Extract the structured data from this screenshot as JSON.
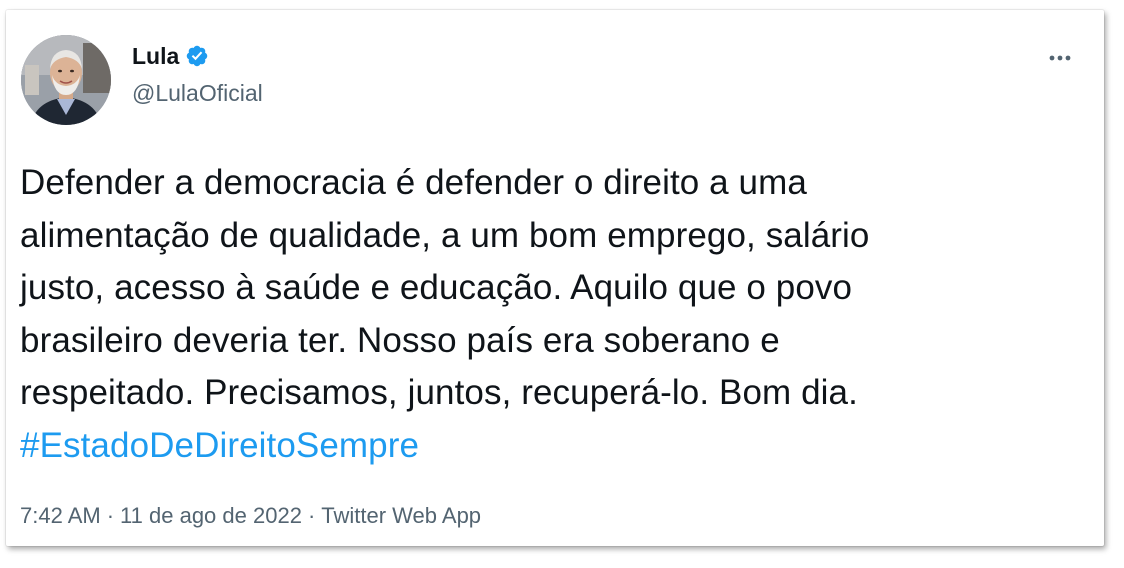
{
  "tweet": {
    "author": {
      "display_name": "Lula",
      "handle": "@LulaOficial",
      "verified": true,
      "verified_icon": "verified-badge-icon",
      "avatar": "avatar-photo"
    },
    "more_icon": "more-options-icon",
    "text_lines": [
      "Defender a democracia é defender o direito a uma",
      "alimentação de qualidade, a um bom emprego, salário",
      "justo, acesso à saúde e educação. Aquilo que o povo",
      "brasileiro deveria ter. Nosso país era soberano e",
      "respeitado. Precisamos, juntos, recuperá-lo. Bom dia."
    ],
    "hashtag": "#EstadoDeDireitoSempre",
    "time": "7:42 AM",
    "separator": "·",
    "date": "11 de ago de 2022",
    "source": "Twitter Web App"
  },
  "colors": {
    "text": "#0f1419",
    "secondary": "#536471",
    "link": "#1d9bf0",
    "verified": "#1d9bf0"
  }
}
